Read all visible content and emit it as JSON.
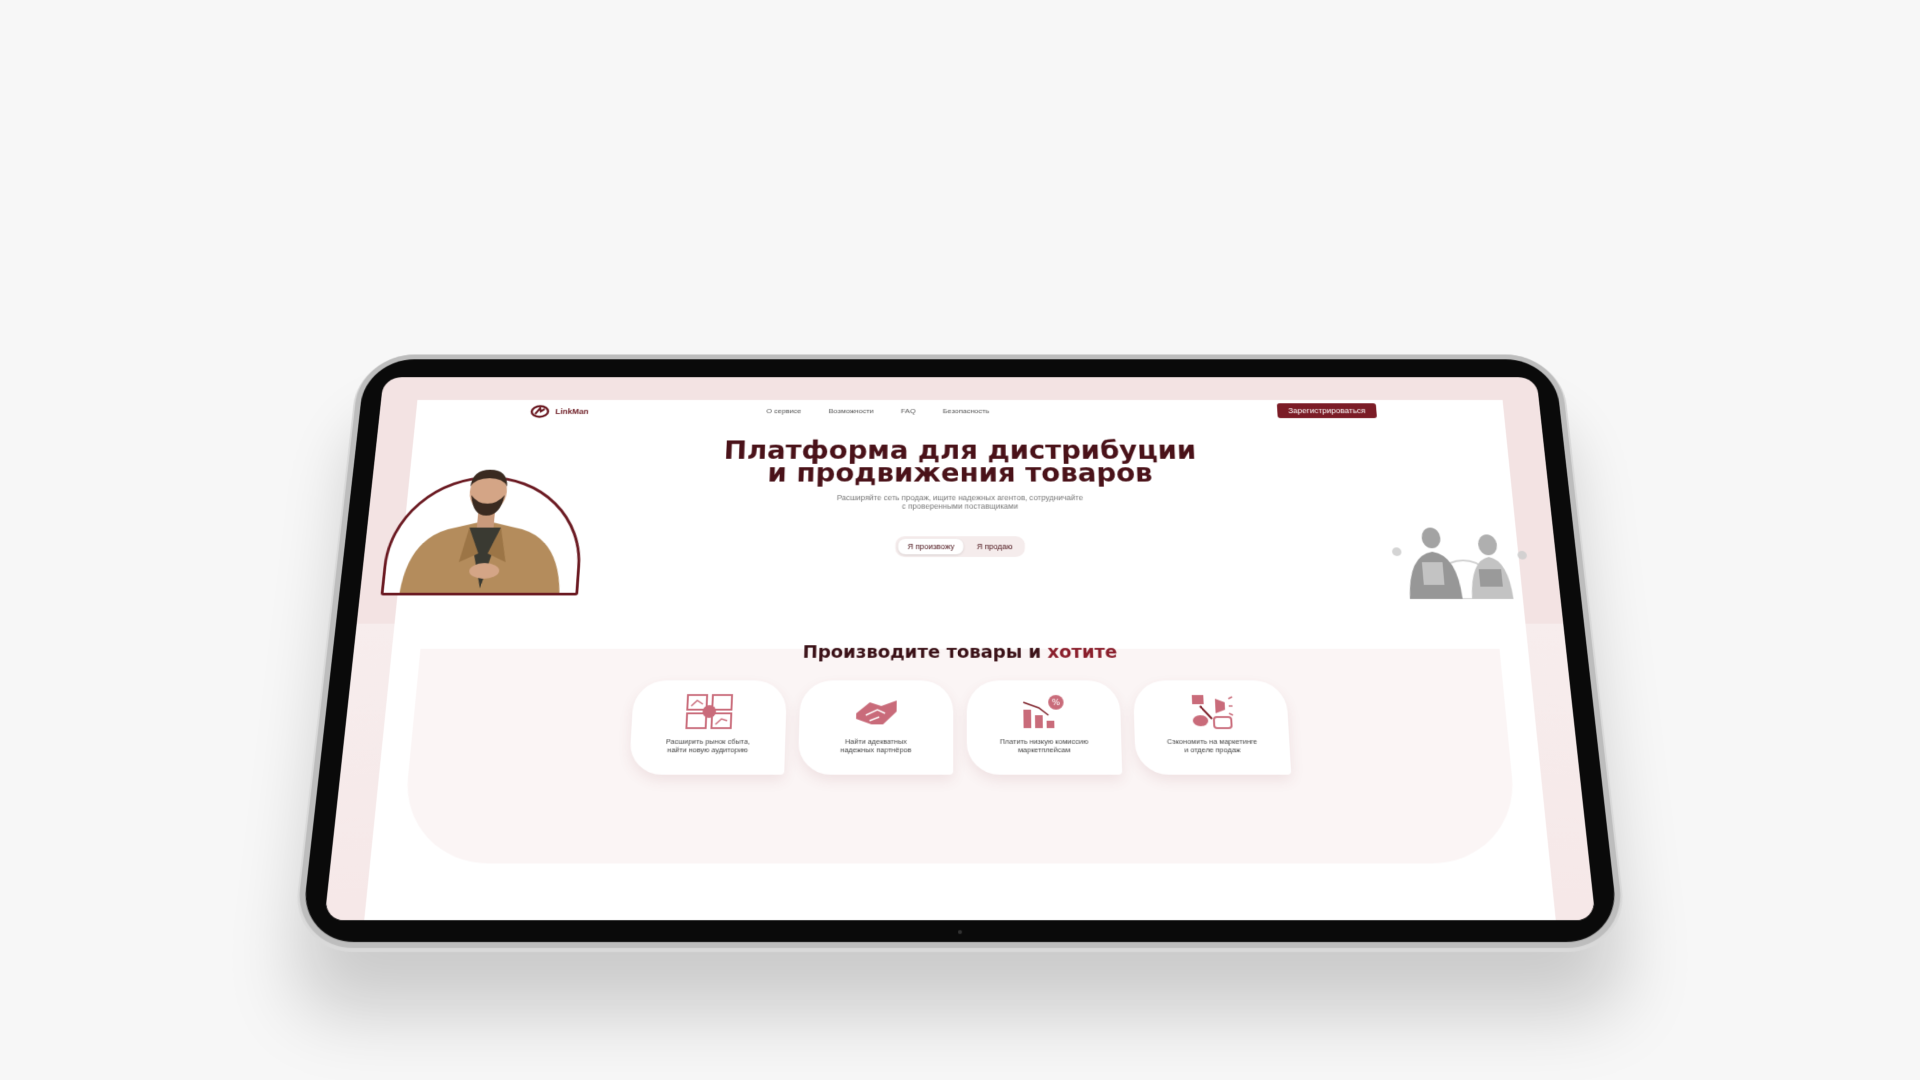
{
  "logo": {
    "text": "LinkMan"
  },
  "nav": {
    "links": [
      "О сервисе",
      "Возможности",
      "FAQ",
      "Безопасность"
    ],
    "register_label": "Зарегистрироваться"
  },
  "hero": {
    "title_line1": "Платформа для дистрибуции",
    "title_line2": "и продвижения товаров",
    "subtitle_line1": "Расширяйте сеть продаж, ищите надежных агентов, сотрудничайте",
    "subtitle_line2": "с проверенными поставщиками",
    "toggle": [
      "Я произвожу",
      "Я продаю"
    ],
    "toggle_active": 0
  },
  "section": {
    "title_main": "Производите товары и ",
    "title_accent": "хотите"
  },
  "cards": [
    {
      "icon": "market-expansion-icon",
      "line1": "Расширить рынок сбыта,",
      "line2": "найти новую аудиторию"
    },
    {
      "icon": "handshake-icon",
      "line1": "Найти адекватных",
      "line2": "надежных партнёров"
    },
    {
      "icon": "low-commission-icon",
      "line1": "Платить низкую комиссию",
      "line2": "маркетплейсам"
    },
    {
      "icon": "marketing-savings-icon",
      "line1": "Сэкономить на маркетинге",
      "line2": "и отделе продаж"
    }
  ],
  "colors": {
    "brand": "#7b1c26",
    "icon": "#c96b7a",
    "title": "#4a1219"
  }
}
